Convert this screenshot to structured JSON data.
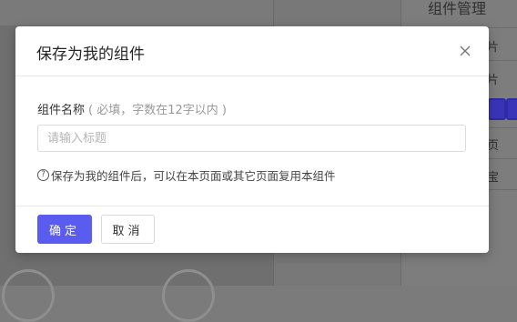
{
  "background": {
    "panel_title": "组件管理",
    "rows": [
      "片",
      "片",
      "页",
      "宝"
    ]
  },
  "modal": {
    "title": "保存为我的组件",
    "close_icon": "close-icon",
    "field_label": "组件名称",
    "field_hint": "( 必填，字数在12字以内 )",
    "input_placeholder": "请输入标题",
    "input_value": "",
    "help_icon_glyph": "?",
    "help_text": "保存为我的组件后，可以在本页面或其它页面复用本组件",
    "confirm_label": "确定",
    "cancel_label": "取消"
  },
  "colors": {
    "primary": "#5a5cf0",
    "overlay": "#7b7b7b"
  }
}
